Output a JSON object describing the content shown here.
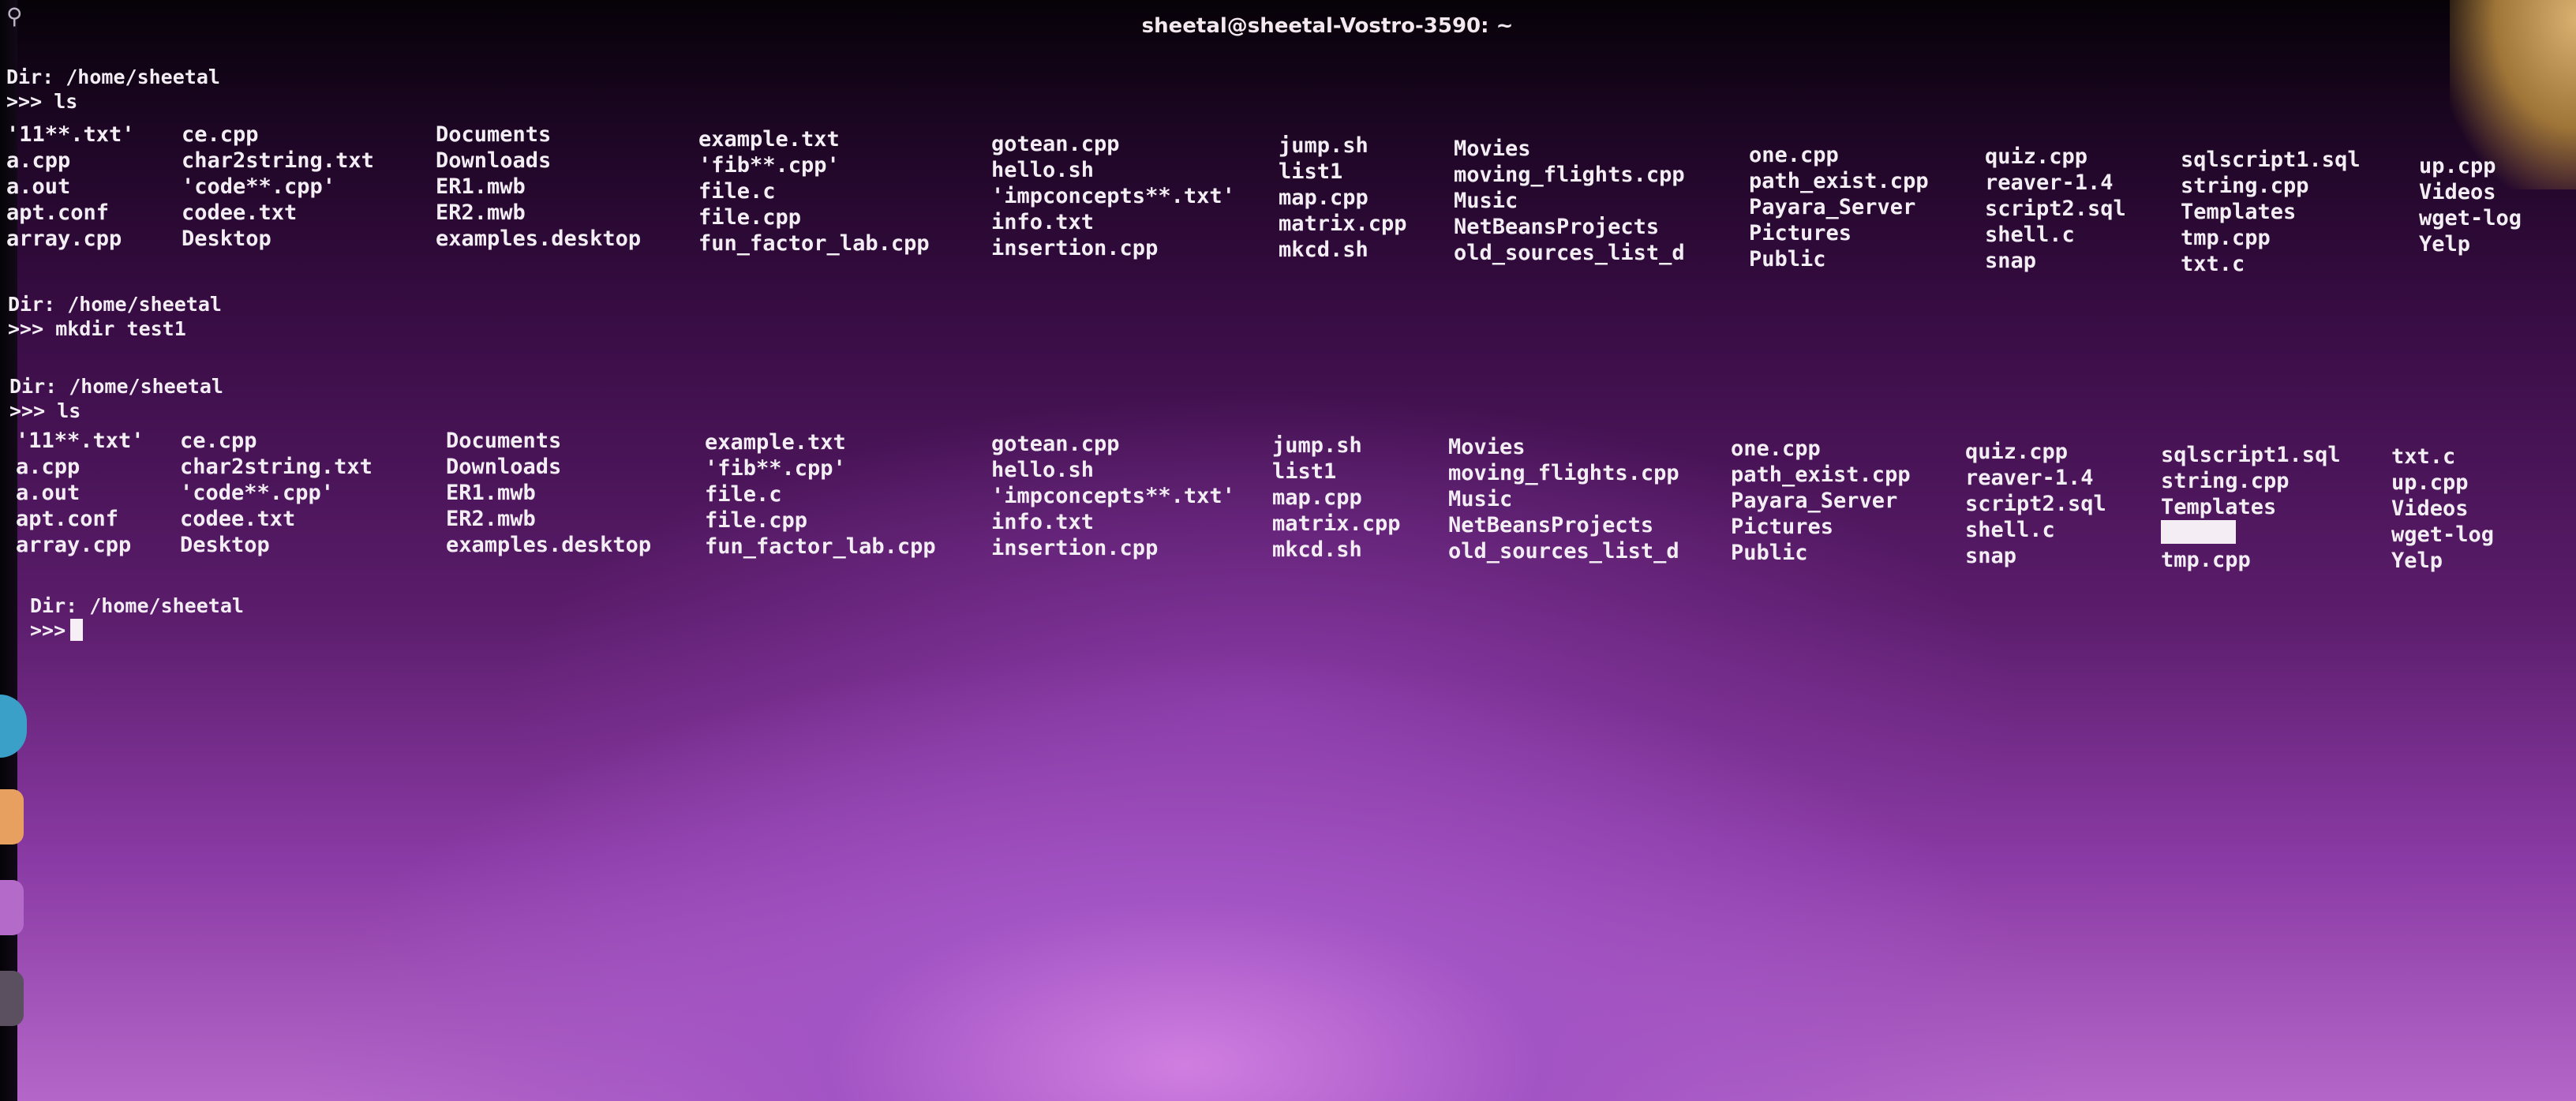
{
  "window": {
    "title": "sheetal@sheetal-Vostro-3590: ~",
    "search_glyph": "⚲"
  },
  "terminal": {
    "blocks": [
      {
        "dir": "Dir: /home/sheetal",
        "command": ">>> ls"
      },
      {
        "dir": "Dir: /home/sheetal",
        "command": ">>> mkdir test1"
      },
      {
        "dir": "Dir: /home/sheetal",
        "command": ">>> ls"
      },
      {
        "dir": "Dir: /home/sheetal",
        "command": ">>>"
      }
    ],
    "listing_1": [
      [
        "'11**.txt'",
        "a.cpp",
        "a.out",
        "apt.conf",
        "array.cpp"
      ],
      [
        "ce.cpp",
        "char2string.txt",
        "'code**.cpp'",
        "codee.txt",
        "Desktop"
      ],
      [
        "Documents",
        "Downloads",
        "ER1.mwb",
        "ER2.mwb",
        "examples.desktop"
      ],
      [
        "example.txt",
        "'fib**.cpp'",
        "file.c",
        "file.cpp",
        "fun_factor_lab.cpp"
      ],
      [
        "gotean.cpp",
        "hello.sh",
        "'impconcepts**.txt'",
        "info.txt",
        "insertion.cpp"
      ],
      [
        "jump.sh",
        "list1",
        "map.cpp",
        "matrix.cpp",
        "mkcd.sh"
      ],
      [
        "Movies",
        "moving_flights.cpp",
        "Music",
        "NetBeansProjects",
        "old_sources_list_d"
      ],
      [
        "one.cpp",
        "path_exist.cpp",
        "Payara_Server",
        "Pictures",
        "Public"
      ],
      [
        "quiz.cpp",
        "reaver-1.4",
        "script2.sql",
        "shell.c",
        "snap"
      ],
      [
        "sqlscript1.sql",
        "string.cpp",
        "Templates",
        "tmp.cpp",
        "txt.c"
      ],
      [
        "up.cpp",
        "Videos",
        "wget-log",
        "Yelp"
      ]
    ],
    "listing_2": [
      [
        "'11**.txt'",
        "a.cpp",
        "a.out",
        "apt.conf",
        "array.cpp"
      ],
      [
        "ce.cpp",
        "char2string.txt",
        "'code**.cpp'",
        "codee.txt",
        "Desktop"
      ],
      [
        "Documents",
        "Downloads",
        "ER1.mwb",
        "ER2.mwb",
        "examples.desktop"
      ],
      [
        "example.txt",
        "'fib**.cpp'",
        "file.c",
        "file.cpp",
        "fun_factor_lab.cpp"
      ],
      [
        "gotean.cpp",
        "hello.sh",
        "'impconcepts**.txt'",
        "info.txt",
        "insertion.cpp"
      ],
      [
        "jump.sh",
        "list1",
        "map.cpp",
        "matrix.cpp",
        "mkcd.sh"
      ],
      [
        "Movies",
        "moving_flights.cpp",
        "Music",
        "NetBeansProjects",
        "old_sources_list_d"
      ],
      [
        "one.cpp",
        "path_exist.cpp",
        "Payara_Server",
        "Pictures",
        "Public"
      ],
      [
        "quiz.cpp",
        "reaver-1.4",
        "script2.sql",
        "shell.c",
        "snap"
      ],
      [
        "sqlscript1.sql",
        "string.cpp",
        "Templates",
        "",
        "tmp.cpp"
      ],
      [
        "txt.c",
        "up.cpp",
        "Videos",
        "wget-log",
        "Yelp"
      ]
    ]
  },
  "colors": {
    "text": "#f3edf4",
    "background_top": "#060208",
    "background_bottom": "#b467c8"
  }
}
